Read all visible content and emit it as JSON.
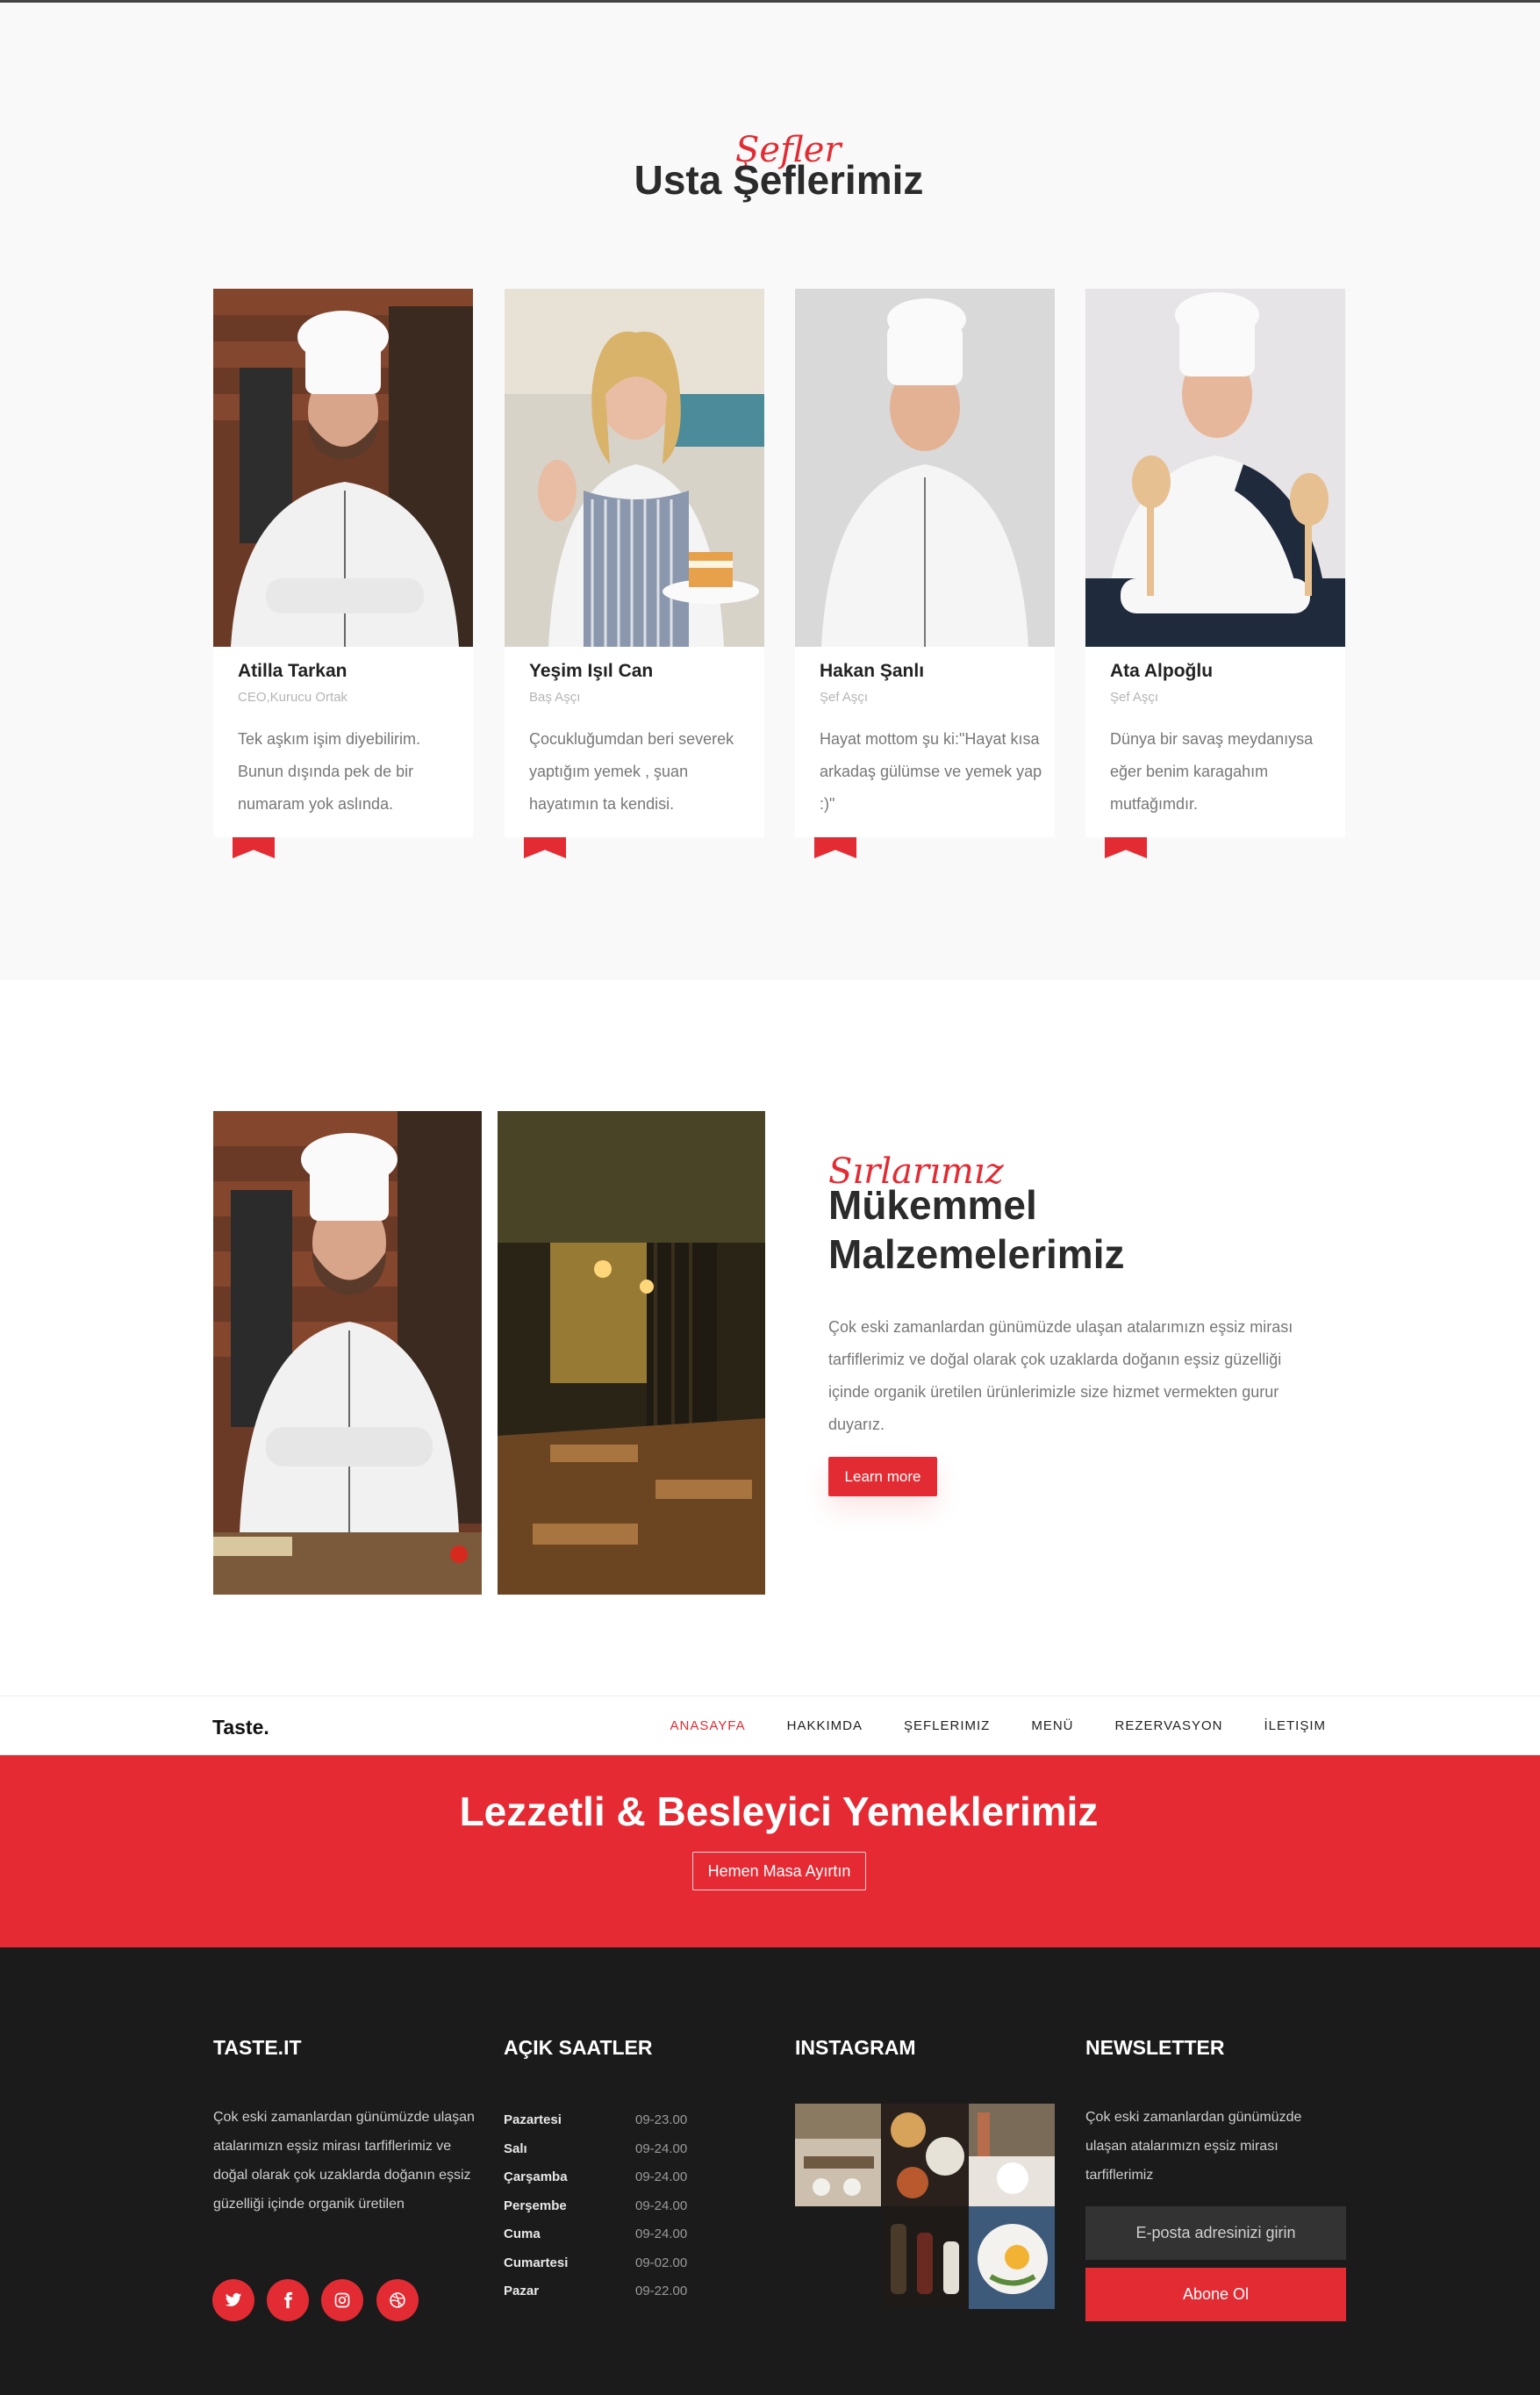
{
  "chefs_section": {
    "script_word": "Şefler",
    "title": "Usta Şeflerimiz",
    "chefs": [
      {
        "name": "Atilla Tarkan",
        "role": "CEO,Kurucu Ortak",
        "desc": "Tek aşkım işim diyebilirim. Bunun dışında pek de bir numaram yok aslında."
      },
      {
        "name": "Yeşim Işıl Can",
        "role": "Baş Aşçı",
        "desc": "Çocukluğumdan beri severek yaptığım yemek , şuan hayatımın ta kendisi."
      },
      {
        "name": "Hakan Şanlı",
        "role": "Şef Aşçı",
        "desc": "Hayat mottom şu ki:\"Hayat kısa arkadaş gülümse ve yemek yap :)\""
      },
      {
        "name": "Ata Alpoğlu",
        "role": "Şef Aşçı",
        "desc": "Dünya bir savaş meydanıysa eğer benim karagahım mutfağımdır."
      }
    ]
  },
  "ingredients_section": {
    "script_word": "Sırlarımız",
    "title_line1": "Mükemmel",
    "title_line2": "Malzemelerimiz",
    "paragraph": "Çok eski zamanlardan günümüzde ulaşan atalarımızn eşsiz mirası tarfiflerimiz ve doğal olarak çok uzaklarda doğanın eşsiz güzelliği içinde organik üretilen ürünlerimizle size hizmet vermekten gurur duyarız.",
    "button": "Learn more"
  },
  "navbar": {
    "brand": "Taste.",
    "items": [
      "ANASAYFA",
      "HAKKIMDA",
      "ŞEFLERIMIZ",
      "MENÜ",
      "REZERVASYON",
      "İLETIŞIM"
    ],
    "active_index": 0
  },
  "banner": {
    "title": "Lezzetli & Besleyici Yemeklerimiz",
    "button": "Hemen Masa Ayırtın"
  },
  "footer": {
    "about": {
      "title": "TASTE.IT",
      "text": "Çok eski zamanlardan günümüzde ulaşan atalarımızn eşsiz mirası tarfiflerimiz ve doğal olarak çok uzaklarda doğanın eşsiz güzelliği içinde organik üretilen",
      "social_icons": [
        "twitter-icon",
        "facebook-icon",
        "instagram-icon",
        "dribbble-icon"
      ]
    },
    "hours": {
      "title": "AÇIK SAATLER",
      "rows": [
        {
          "day": "Pazartesi",
          "time": "09-23.00"
        },
        {
          "day": "Salı",
          "time": "09-24.00"
        },
        {
          "day": "Çarşamba",
          "time": "09-24.00"
        },
        {
          "day": "Perşembe",
          "time": "09-24.00"
        },
        {
          "day": "Cuma",
          "time": "09-24.00"
        },
        {
          "day": "Cumartesi",
          "time": "09-02.00"
        },
        {
          "day": "Pazar",
          "time": "09-22.00"
        }
      ]
    },
    "instagram": {
      "title": "INSTAGRAM"
    },
    "newsletter": {
      "title": "NEWSLETTER",
      "text": "Çok eski zamanlardan günümüzde ulaşan atalarımızn eşsiz mirası tarfiflerimiz",
      "placeholder": "E-posta adresinizi girin",
      "button": "Abone Ol"
    }
  },
  "colors": {
    "accent": "#e32b33",
    "footer_bg": "#1b1b1c",
    "section_bg": "#f9f9f9"
  }
}
